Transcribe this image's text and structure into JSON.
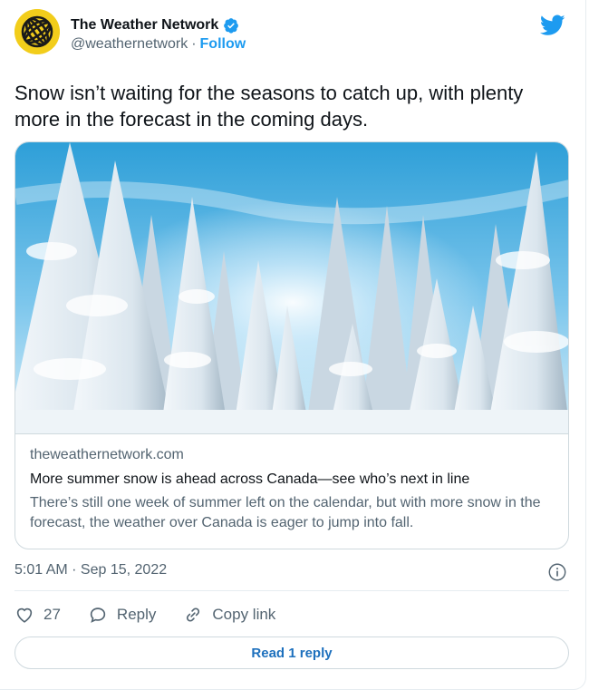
{
  "account": {
    "display_name": "The Weather Network",
    "handle": "@weathernetwork",
    "separator": "·",
    "follow_label": "Follow"
  },
  "tweet": {
    "text": "Snow isn’t waiting for the seasons to catch up, with plenty more in the forecast in the coming days."
  },
  "card": {
    "domain": "theweathernetwork.com",
    "title": "More summer snow is ahead across Canada—see who’s next in line",
    "description": "There’s still one week of summer left on the calendar, but with more snow in the forecast, the weather over Canada is eager to jump into fall.",
    "image_icon": "snowy-forest-photo"
  },
  "meta": {
    "timestamp": "5:01 AM · Sep 15, 2022"
  },
  "actions": {
    "like_count": "27",
    "reply_label": "Reply",
    "copy_link_label": "Copy link"
  },
  "read_reply_label": "Read 1 reply",
  "colors": {
    "accent": "#1d9bf0",
    "secondary_text": "#536471",
    "border": "#cfd9de",
    "avatar_bg": "#f2cd1b"
  }
}
